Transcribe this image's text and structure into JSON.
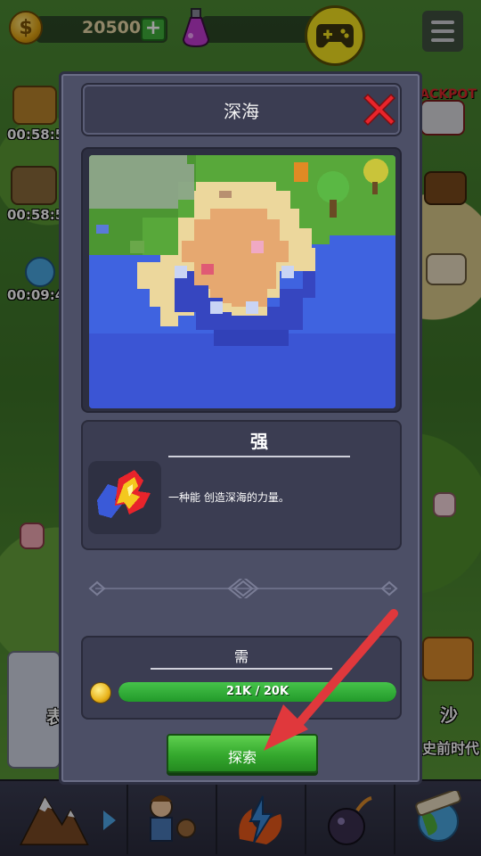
{
  "topbar": {
    "coin_amount": "20500",
    "coin_icon_glyph": "$",
    "add_label": "+"
  },
  "side_timers": [
    "00:58:5",
    "00:58:5",
    "00:09:4"
  ],
  "right_side": {
    "jackpot_label": "JACKPOT",
    "bottom_right_label": "沙",
    "bottom_right_sub": "史前时代"
  },
  "left_side": {
    "bottom_left_label": "表"
  },
  "modal": {
    "title": "深海",
    "info": {
      "heading": "强",
      "description": "一种能 创造深海的力量。"
    },
    "requirement": {
      "heading": "需",
      "progress_text": "21K / 20K",
      "progress_fraction": 1.0
    },
    "explore_label": "探索"
  },
  "colors": {
    "modal_bg": "#4c4f66",
    "panel_bg": "#3b3d52",
    "accent_green": "#34a82d",
    "close_red": "#e8242b",
    "gamepad_yellow": "#f4e320",
    "arrow_red": "#e0383c"
  },
  "icons": {
    "coin": "coin-icon",
    "potion": "potion-icon",
    "gamepad": "gamepad-icon",
    "menu": "menu-icon",
    "close": "close-icon",
    "power": "fire-lightning-icon",
    "requirement_coin": "coin-icon"
  }
}
